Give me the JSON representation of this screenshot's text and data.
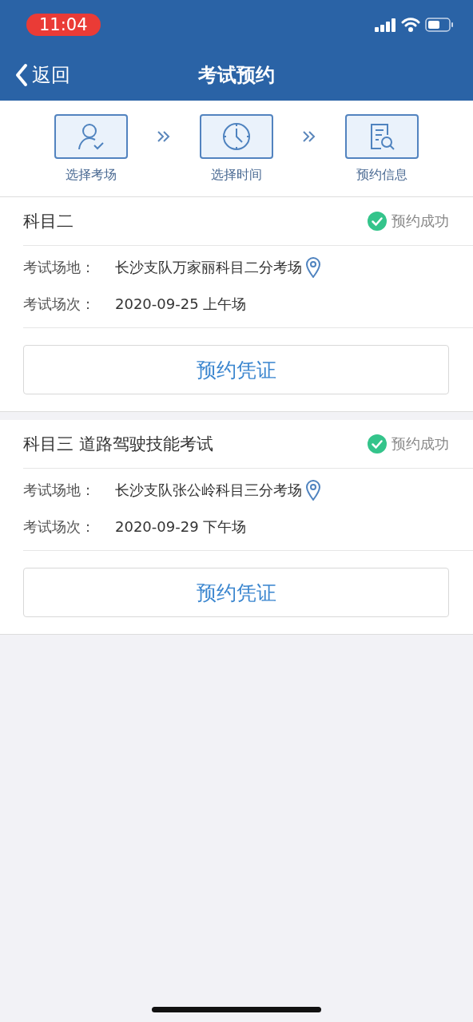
{
  "status_bar": {
    "time": "11:04"
  },
  "nav": {
    "back": "返回",
    "title": "考试预约"
  },
  "steps": [
    {
      "label": "选择考场",
      "kind": "user"
    },
    {
      "label": "选择时间",
      "kind": "time"
    },
    {
      "label": "预约信息",
      "kind": "info"
    }
  ],
  "bookings": [
    {
      "subject": "科目二",
      "status": {
        "kind": "success",
        "text": "预约成功"
      },
      "fields": [
        {
          "label": "考试场地：",
          "value": "长沙支队万家丽科目二分考场",
          "has_location": true
        },
        {
          "label": "考试场次：",
          "value": "2020-09-25 上午场",
          "has_location": false
        }
      ],
      "button": "预约凭证"
    },
    {
      "subject": "科目三 道路驾驶技能考试",
      "status": {
        "kind": "success",
        "text": "预约成功"
      },
      "fields": [
        {
          "label": "考试场地：",
          "value": "长沙支队张公岭科目三分考场",
          "has_location": true
        },
        {
          "label": "考试场次：",
          "value": "2020-09-29 下午场",
          "has_location": false
        }
      ],
      "button": "预约凭证"
    }
  ]
}
